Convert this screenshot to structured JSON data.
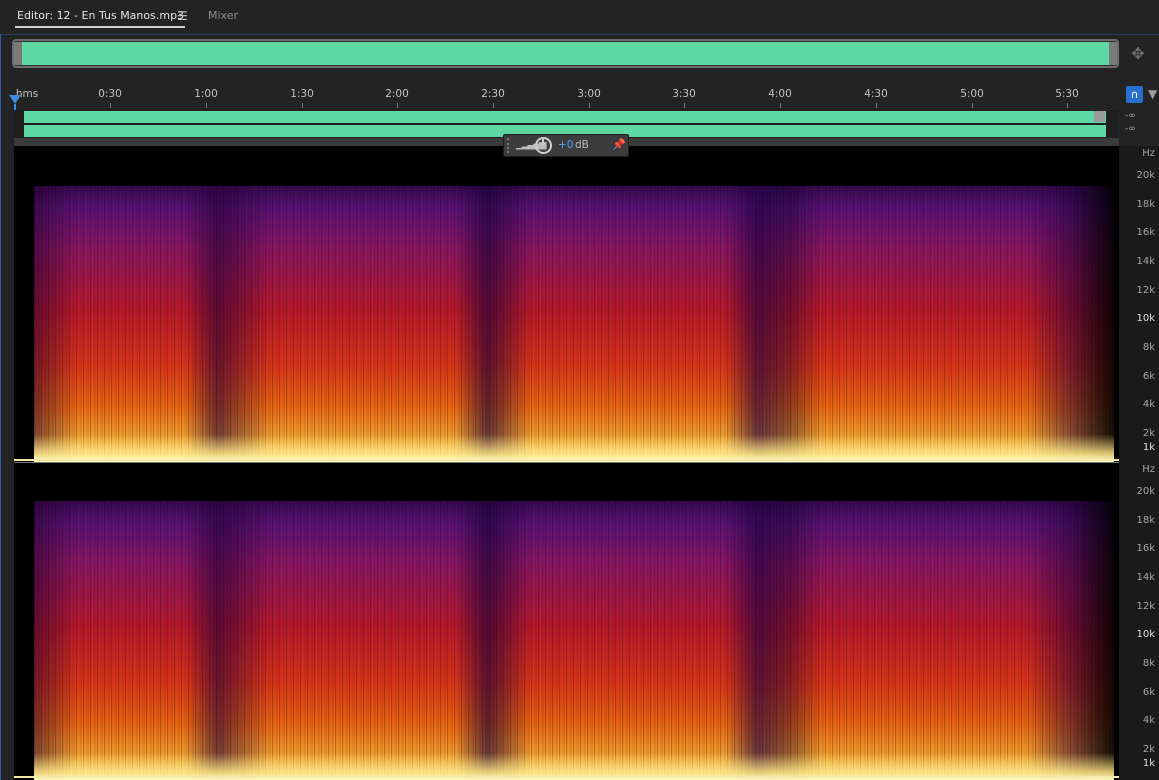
{
  "tabs": {
    "editor": "Editor: 12 - En Tus Manos.mp3",
    "menu_glyph": "☰",
    "mixer": "Mixer"
  },
  "ruler": {
    "unit": "hms",
    "ticks": [
      "0:30",
      "1:00",
      "1:30",
      "2:00",
      "2:30",
      "3:00",
      "3:30",
      "4:00",
      "4:30",
      "5:00",
      "5:30"
    ]
  },
  "db_scale": [
    "-∞",
    "-∞"
  ],
  "hud": {
    "value": "+0",
    "unit": "dB"
  },
  "spectrogram": {
    "hz_unit": "Hz",
    "hz_labels": [
      "20k",
      "18k",
      "16k",
      "14k",
      "12k",
      "10k",
      "8k",
      "6k",
      "4k",
      "2k",
      "1k"
    ]
  },
  "colors": {
    "waveform": "#5fd9a3",
    "accent_blue": "#2a6fd0",
    "hud_value": "#4da3ff"
  },
  "icons": {
    "zoom_nav": "zoom-navigator-icon",
    "snap": "snap-magnet-icon",
    "marker": "marker-icon",
    "pin": "pin-icon"
  }
}
